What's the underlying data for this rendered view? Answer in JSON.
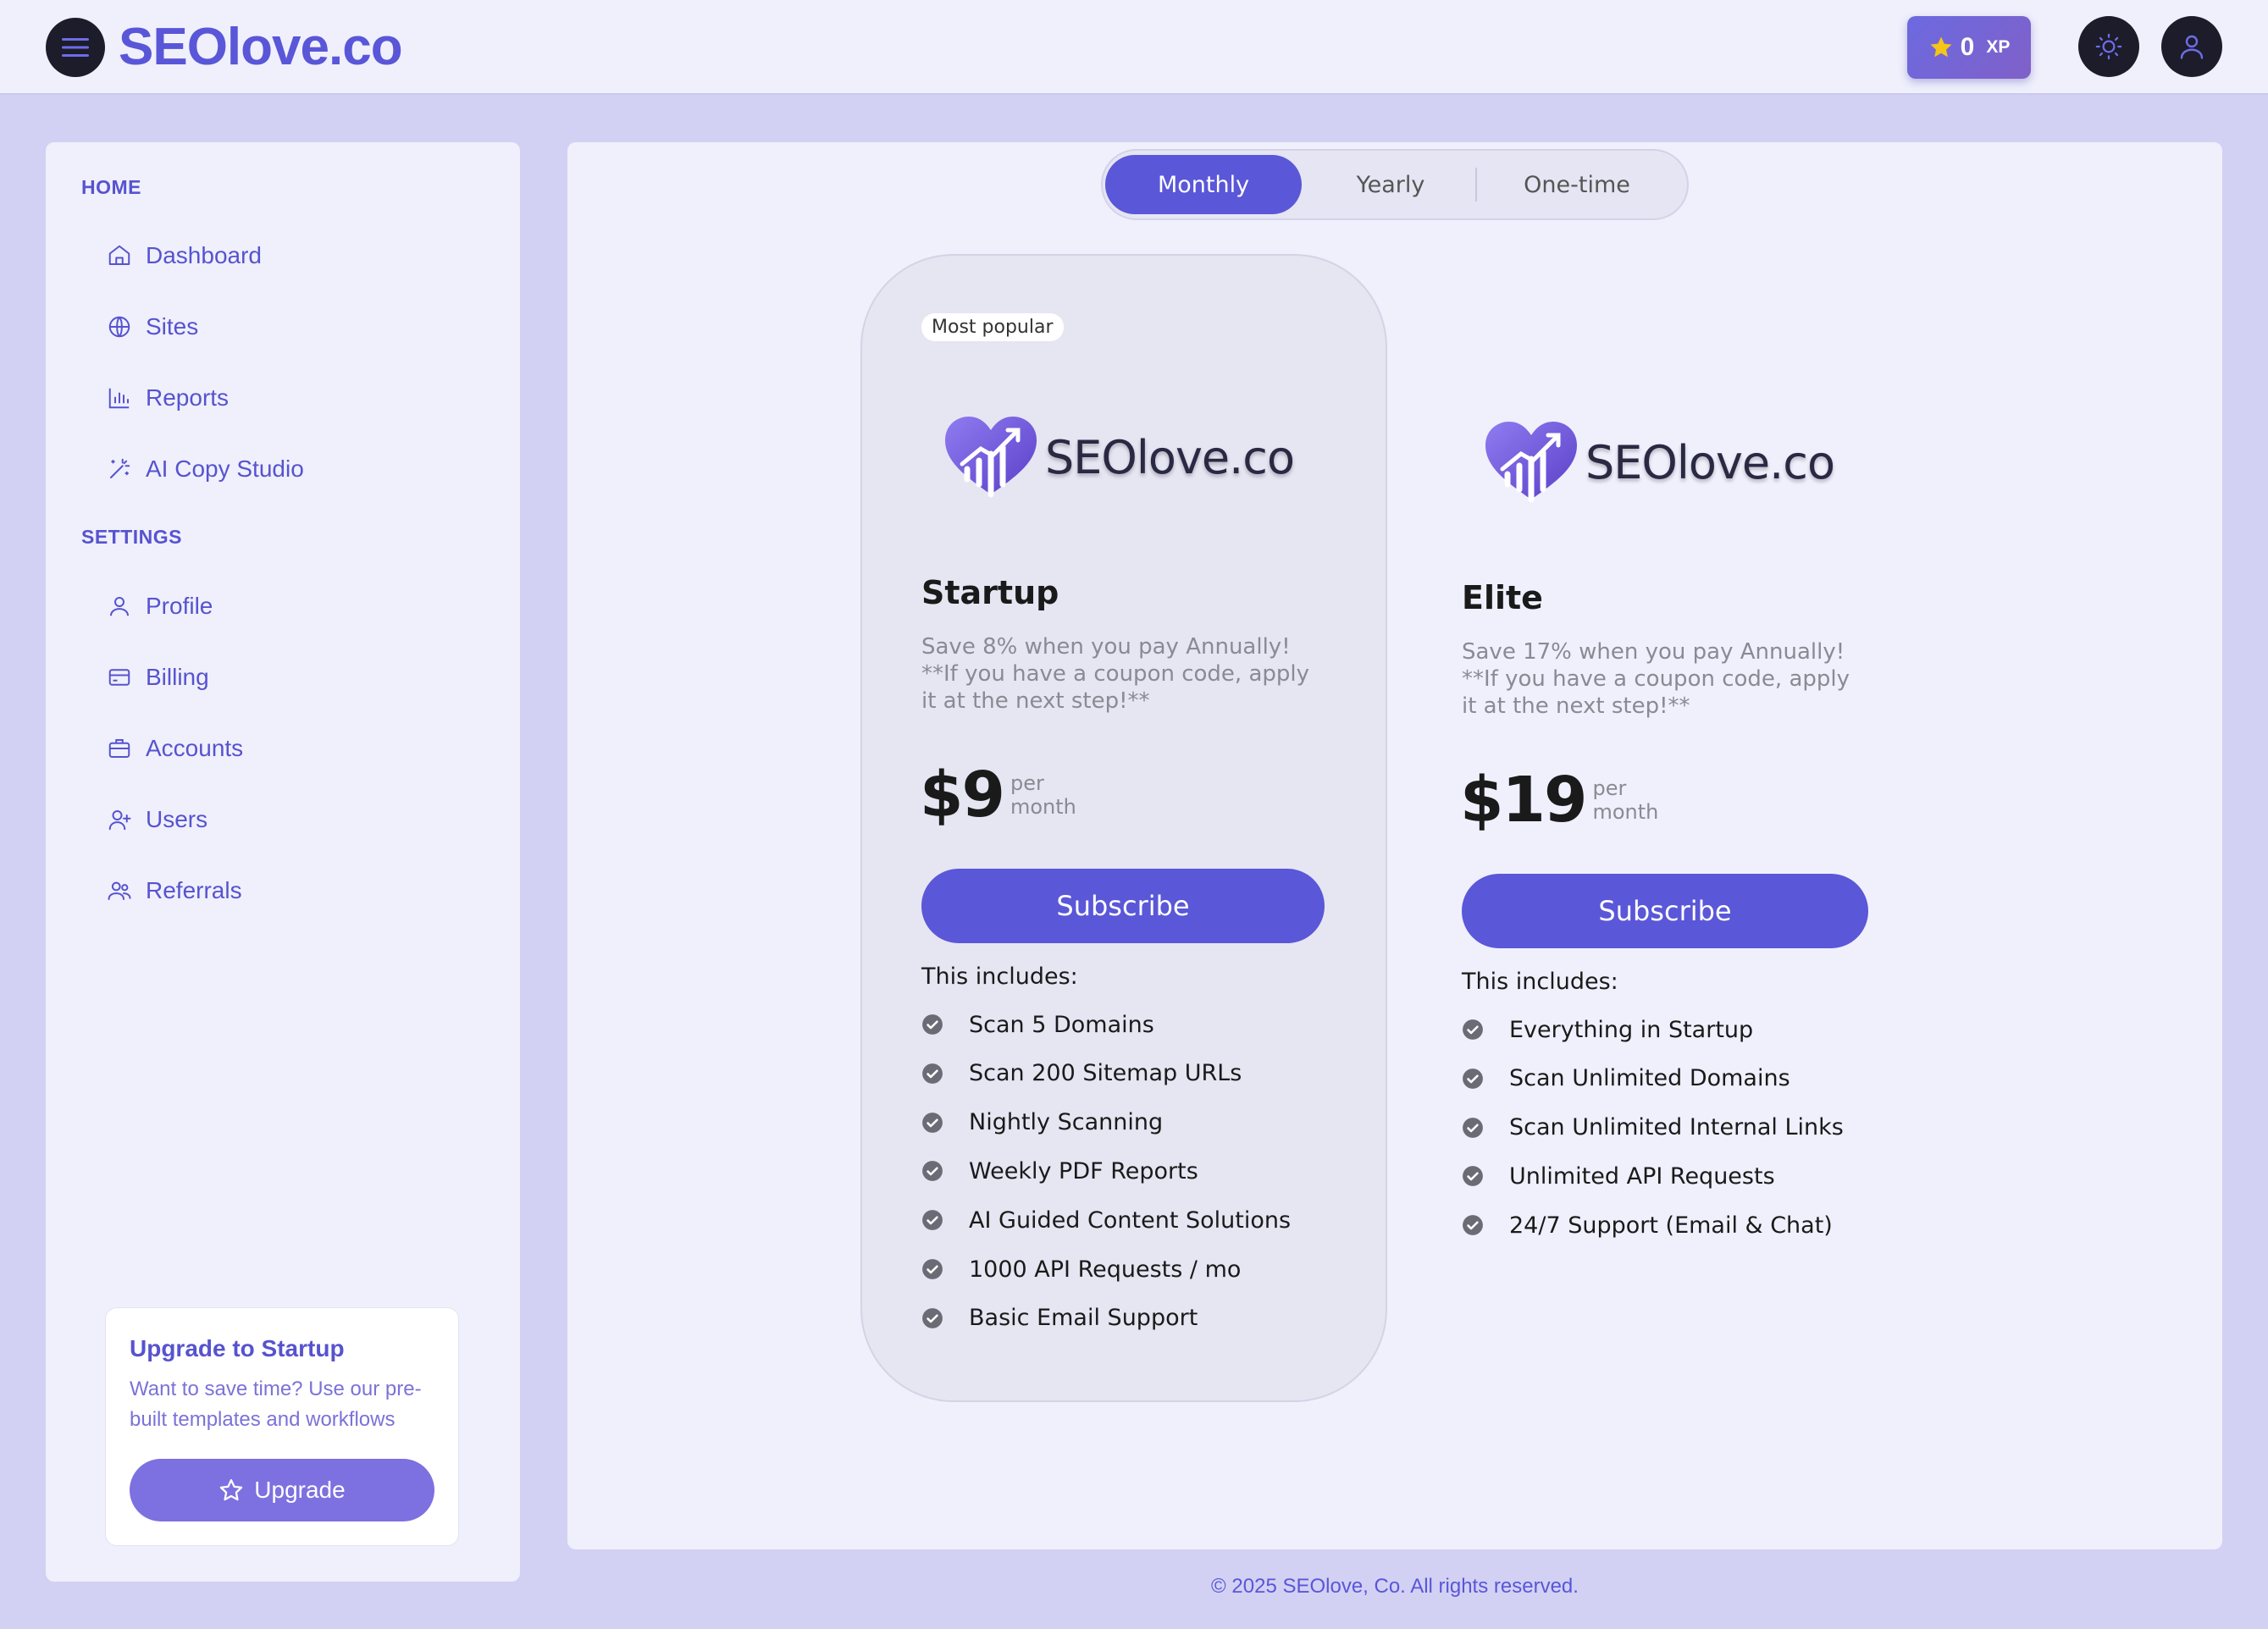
{
  "header": {
    "brand": "SEOlove.co",
    "xp_value": "0",
    "xp_label": "XP"
  },
  "sidebar": {
    "home_title": "HOME",
    "settings_title": "SETTINGS",
    "home_items": [
      {
        "label": "Dashboard",
        "icon": "home-icon"
      },
      {
        "label": "Sites",
        "icon": "globe-icon"
      },
      {
        "label": "Reports",
        "icon": "bar-chart-icon"
      },
      {
        "label": "AI Copy Studio",
        "icon": "magic-wand-icon"
      }
    ],
    "settings_items": [
      {
        "label": "Profile",
        "icon": "user-icon"
      },
      {
        "label": "Billing",
        "icon": "credit-card-icon"
      },
      {
        "label": "Accounts",
        "icon": "briefcase-icon"
      },
      {
        "label": "Users",
        "icon": "user-plus-icon"
      },
      {
        "label": "Referrals",
        "icon": "users-icon"
      }
    ],
    "upgrade": {
      "title": "Upgrade to Startup",
      "text": "Want to save time? Use our pre-built templates and workflows",
      "button": "Upgrade"
    }
  },
  "billing_toggle": {
    "options": [
      "Monthly",
      "Yearly",
      "One-time"
    ],
    "selected": "Monthly"
  },
  "plans": [
    {
      "badge": "Most popular",
      "logo_text": "SEOlove.co",
      "name": "Startup",
      "description": "Save 8% when you pay Annually! **If you have a coupon code, apply it at the next step!**",
      "price": "$9",
      "per": "per",
      "period": "month",
      "button": "Subscribe",
      "includes_label": "This includes:",
      "features": [
        "Scan 5 Domains",
        "Scan 200 Sitemap URLs",
        "Nightly Scanning",
        "Weekly PDF Reports",
        "AI Guided Content Solutions",
        "1000 API Requests / mo",
        "Basic Email Support"
      ]
    },
    {
      "logo_text": "SEOlove.co",
      "name": "Elite",
      "description": "Save 17% when you pay Annually! **If you have a coupon code, apply it at the next step!**",
      "price": "$19",
      "per": "per",
      "period": "month",
      "button": "Subscribe",
      "includes_label": "This includes:",
      "features": [
        "Everything in Startup",
        "Scan Unlimited Domains",
        "Scan Unlimited Internal Links",
        "Unlimited API Requests",
        "24/7 Support (Email & Chat)"
      ]
    }
  ],
  "footer": "© 2025 SEOlove, Co. All rights reserved.",
  "colors": {
    "accent": "#5a57d8",
    "page_bg": "#d2d1f3",
    "panel_bg": "#eff0fc"
  }
}
